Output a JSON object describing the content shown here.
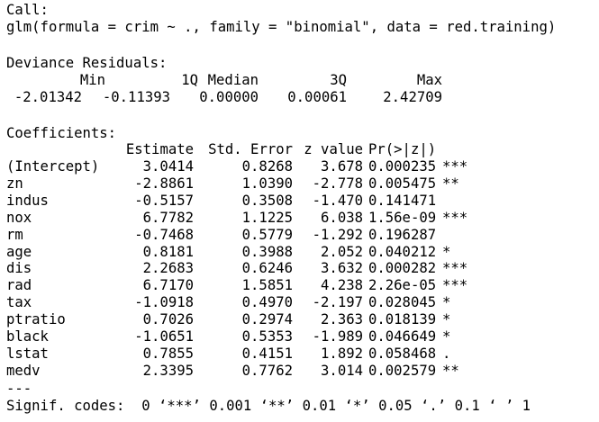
{
  "call": {
    "label": "Call:",
    "formula": "glm(formula = crim ~ ., family = \"binomial\", data = red.training)"
  },
  "residuals": {
    "label": "Deviance Residuals:",
    "headers": [
      "Min",
      "1Q",
      "Median",
      "3Q",
      "Max"
    ],
    "values": [
      "-2.01342",
      "-0.11393",
      "0.00000",
      "0.00061",
      "2.42709"
    ]
  },
  "coefficients": {
    "label": "Coefficients:",
    "headers": [
      "Estimate",
      "Std. Error",
      "z value",
      "Pr(>|z|)"
    ],
    "rows": [
      {
        "term": "(Intercept)",
        "estimate": "3.0414",
        "std_error": "0.8268",
        "z_value": "3.678",
        "p_value": "0.000235",
        "signif": "***"
      },
      {
        "term": "zn",
        "estimate": "-2.8861",
        "std_error": "1.0390",
        "z_value": "-2.778",
        "p_value": "0.005475",
        "signif": "**"
      },
      {
        "term": "indus",
        "estimate": "-0.5157",
        "std_error": "0.3508",
        "z_value": "-1.470",
        "p_value": "0.141471",
        "signif": ""
      },
      {
        "term": "nox",
        "estimate": "6.7782",
        "std_error": "1.1225",
        "z_value": "6.038",
        "p_value": "1.56e-09",
        "signif": "***"
      },
      {
        "term": "rm",
        "estimate": "-0.7468",
        "std_error": "0.5779",
        "z_value": "-1.292",
        "p_value": "0.196287",
        "signif": ""
      },
      {
        "term": "age",
        "estimate": "0.8181",
        "std_error": "0.3988",
        "z_value": "2.052",
        "p_value": "0.040212",
        "signif": "*"
      },
      {
        "term": "dis",
        "estimate": "2.2683",
        "std_error": "0.6246",
        "z_value": "3.632",
        "p_value": "0.000282",
        "signif": "***"
      },
      {
        "term": "rad",
        "estimate": "6.7170",
        "std_error": "1.5851",
        "z_value": "4.238",
        "p_value": "2.26e-05",
        "signif": "***"
      },
      {
        "term": "tax",
        "estimate": "-1.0918",
        "std_error": "0.4970",
        "z_value": "-2.197",
        "p_value": "0.028045",
        "signif": "*"
      },
      {
        "term": "ptratio",
        "estimate": "0.7026",
        "std_error": "0.2974",
        "z_value": "2.363",
        "p_value": "0.018139",
        "signif": "*"
      },
      {
        "term": "black",
        "estimate": "-1.0651",
        "std_error": "0.5353",
        "z_value": "-1.989",
        "p_value": "0.046649",
        "signif": "*"
      },
      {
        "term": "lstat",
        "estimate": "0.7855",
        "std_error": "0.4151",
        "z_value": "1.892",
        "p_value": "0.058468",
        "signif": "."
      },
      {
        "term": "medv",
        "estimate": "2.3395",
        "std_error": "0.7762",
        "z_value": "3.014",
        "p_value": "0.002579",
        "signif": "**"
      }
    ]
  },
  "separator": "---",
  "signif_codes": "Signif. codes:  0 ‘***’ 0.001 ‘**’ 0.01 ‘*’ 0.05 ‘.’ 0.1 ‘ ’ 1"
}
